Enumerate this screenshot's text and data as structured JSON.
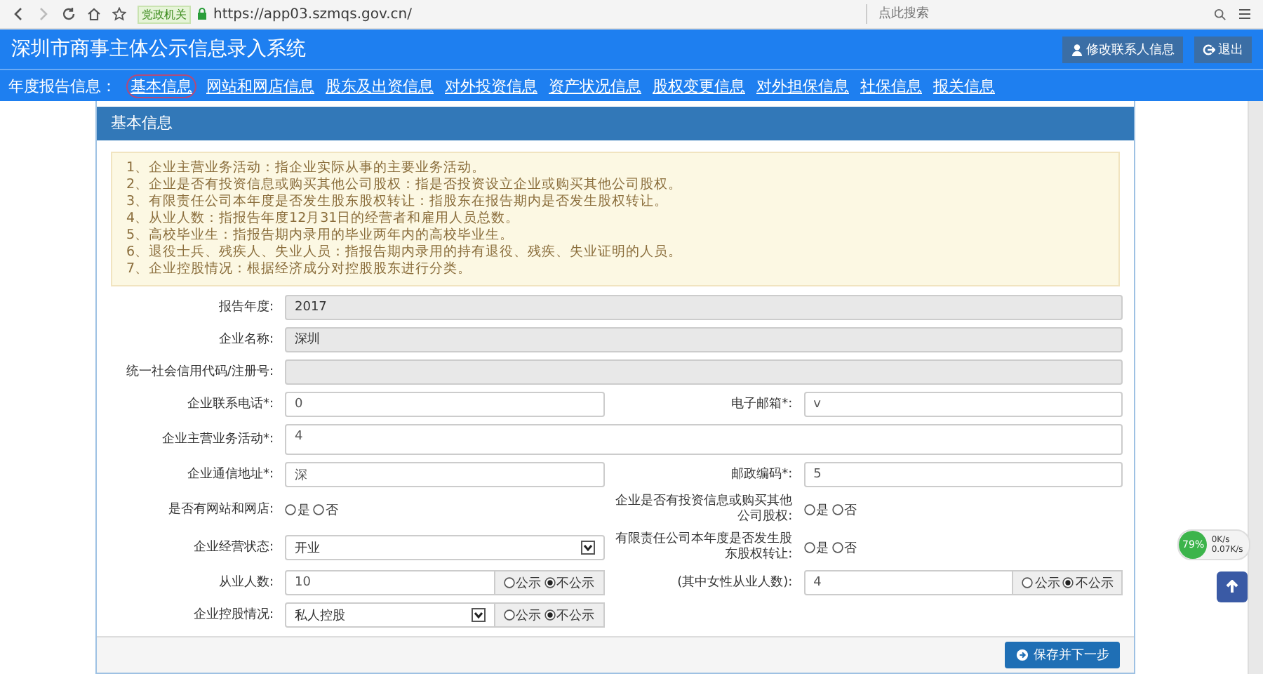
{
  "browser": {
    "badge": "党政机关",
    "url": "https://app03.szmqs.gov.cn/",
    "search_placeholder": "点此搜索"
  },
  "header": {
    "title": "深圳市商事主体公示信息录入系统",
    "buttons": [
      {
        "label": "修改联系人信息",
        "kind": "user"
      },
      {
        "label": "退出",
        "kind": "exit"
      }
    ]
  },
  "nav": {
    "label": "年度报告信息：",
    "links": [
      {
        "label": "基本信息",
        "selected": true
      },
      {
        "label": "网站和网店信息",
        "selected": false
      },
      {
        "label": "股东及出资信息",
        "selected": false
      },
      {
        "label": "对外投资信息",
        "selected": false
      },
      {
        "label": "资产状况信息",
        "selected": false
      },
      {
        "label": "股权变更信息",
        "selected": false
      },
      {
        "label": "对外担保信息",
        "selected": false
      },
      {
        "label": "社保信息",
        "selected": false
      },
      {
        "label": "报关信息",
        "selected": false
      }
    ]
  },
  "panel": {
    "title": "基本信息",
    "notes": [
      "1、企业主营业务活动：指企业实际从事的主要业务活动。",
      "2、企业是否有投资信息或购买其他公司股权：指是否投资设立企业或购买其他公司股权。",
      "3、有限责任公司本年度是否发生股东股权转让：指股东在报告期内是否发生股权转让。",
      "4、从业人数：指报告年度12月31日的经营者和雇用人员总数。",
      "5、高校毕业生：指报告期内录用的毕业两年内的高校毕业生。",
      "6、退役士兵、残疾人、失业人员：指报告期内录用的持有退役、残疾、失业证明的人员。",
      "7、企业控股情况：根据经济成分对控股股东进行分类。"
    ],
    "fields": [
      {
        "label": "报告年度:",
        "kind": "readonly",
        "value": "2017"
      },
      {
        "label": "企业名称:",
        "kind": "readonly",
        "value": "深圳"
      },
      {
        "label": "统一社会信用代码/注册号:",
        "kind": "readonly"
      },
      {
        "label": "企业联系电话*:",
        "kind": "text",
        "value": "0"
      },
      {
        "label": "电子邮箱*:",
        "kind": "text",
        "value": "v"
      },
      {
        "label": "企业主营业务活动*:",
        "kind": "textarea",
        "value": "4"
      },
      {
        "label": "企业通信地址*:",
        "kind": "text",
        "value": "深"
      },
      {
        "label": "邮政编码*:",
        "kind": "text",
        "value": "5"
      },
      {
        "label": "是否有网站和网店:",
        "kind": "radio",
        "options": [
          {
            "label": "是",
            "selected": false
          },
          {
            "label": "否",
            "selected": false
          }
        ]
      },
      {
        "label": "企业是否有投资信息或购买其他公司股权:",
        "kind": "radio",
        "options": [
          {
            "label": "是",
            "selected": false
          },
          {
            "label": "否",
            "selected": false
          }
        ]
      },
      {
        "label": "企业经营状态:",
        "kind": "select",
        "value": "开业"
      },
      {
        "label": "有限责任公司本年度是否发生股东股权转让:",
        "kind": "radio",
        "options": [
          {
            "label": "是",
            "selected": false
          },
          {
            "label": "否",
            "selected": false
          }
        ]
      },
      {
        "label": "从业人数:",
        "kind": "text_public",
        "value": "10",
        "options": [
          {
            "label": "公示",
            "selected": false
          },
          {
            "label": "不公示",
            "selected": true
          }
        ]
      },
      {
        "label": "(其中女性从业人数):",
        "kind": "text_public",
        "value": "4",
        "options": [
          {
            "label": "公示",
            "selected": false
          },
          {
            "label": "不公示",
            "selected": true
          }
        ]
      },
      {
        "label": "企业控股情况:",
        "kind": "select_public",
        "value": "私人控股",
        "options": [
          {
            "label": "公示",
            "selected": false
          },
          {
            "label": "不公示",
            "selected": true
          }
        ]
      }
    ],
    "save_button": "保存并下一步"
  },
  "speed_widget": {
    "percent": "79%",
    "up": "0K/s",
    "down": "0.07K/s"
  }
}
